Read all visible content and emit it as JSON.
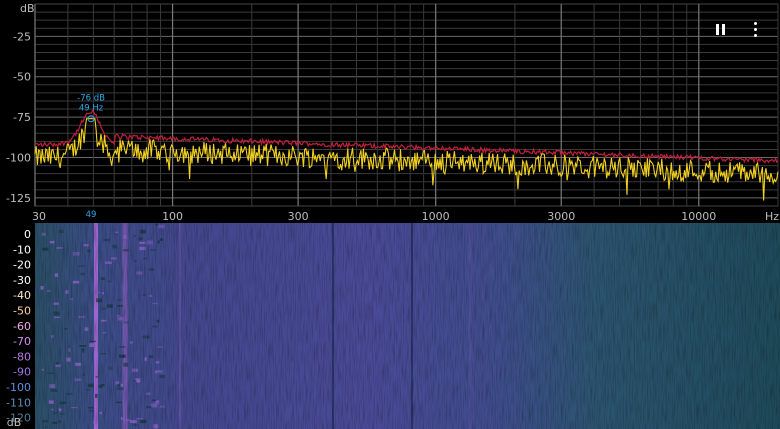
{
  "units": {
    "db": "dB",
    "hz": "Hz"
  },
  "spectrum": {
    "db_ticks": [
      "-25",
      "-50",
      "-75",
      "-100",
      "-125"
    ],
    "db_tick_values": [
      -25,
      -50,
      -75,
      -100,
      -125
    ],
    "db_range": [
      -130,
      -5
    ],
    "freq_ticks": [
      "30",
      "100",
      "300",
      "1000",
      "3000",
      "10000"
    ],
    "freq_tick_values": [
      30,
      100,
      300,
      1000,
      3000,
      10000
    ],
    "freq_range": [
      30,
      20000
    ],
    "freq_scale": "log",
    "peak": {
      "db_label": "-76 dB",
      "hz_label": "49 Hz",
      "marker": "49",
      "db": -76,
      "hz": 49
    },
    "live_color": "#f0d020",
    "peak_hold_color": "#c0203a",
    "grid_color": "#3a3a3a",
    "label_color": "#bdbdbd",
    "peak_label_color": "#2ea8e8"
  },
  "spectrogram": {
    "db_ticks": [
      "0",
      "-10",
      "-20",
      "-30",
      "-40",
      "-50",
      "-60",
      "-70",
      "-80",
      "-90",
      "-100",
      "-110",
      "-120"
    ],
    "db_tick_colors": [
      "#ffffff",
      "#ffffff",
      "#ffffff",
      "#ffffff",
      "#ffe6c8",
      "#ffd0a0",
      "#f0a8e8",
      "#d290f0",
      "#b57ae8",
      "#9a78e0",
      "#5f8ee0",
      "#5a8fb8",
      "#4d7e9a"
    ],
    "unit_label": "dB",
    "palette": [
      "#1d3d4a",
      "#2c4f6b",
      "#3f4f8f",
      "#6a4ca8",
      "#9a5fc8"
    ]
  },
  "controls": {
    "pause_icon": "pause-icon",
    "menu_icon": "more-vert-icon"
  }
}
